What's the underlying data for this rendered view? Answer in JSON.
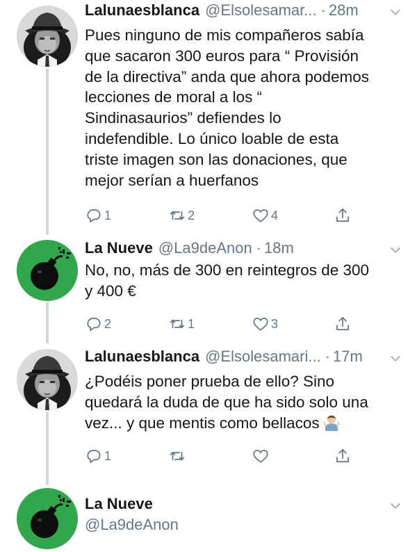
{
  "tweets": [
    {
      "display_name": "Lalunaesblanca",
      "handle": "@Elsolesamar...",
      "time": "28m",
      "text": "Pues ninguno de mis compañeros sabía\nque sacaron 300 euros para “ Provisión\nde la directiva” anda que ahora podemos\nlecciones de moral a los “\nSindinasaurios” defiendes lo\nindefendible. Lo único loable de esta\ntriste imagen son las donaciones, que\nmejor serían a huerfanos",
      "replies": "1",
      "retweets": "2",
      "likes": "4",
      "avatar_icon": "gangster-avatar-icon"
    },
    {
      "display_name": "La Nueve",
      "handle": "@La9deAnon",
      "time": "18m",
      "text": "No, no, más de 300 en reintegros de 300\ny 400 €",
      "replies": "2",
      "retweets": "1",
      "likes": "3",
      "avatar_icon": "bomb-avatar-icon"
    },
    {
      "display_name": "Lalunaesblanca",
      "handle": "@Elsolesamari...",
      "time": "17m",
      "text": "¿Podéis poner prueba de ello? Sino\nquedará la duda de que ha sido solo una\nvez... y que mentis como bellacos",
      "emoji": "shrug-emoji",
      "replies": "1",
      "retweets": "",
      "likes": "",
      "avatar_icon": "gangster-avatar-icon"
    },
    {
      "display_name": "La Nueve",
      "handle": "@La9deAnon",
      "avatar_icon": "bomb-avatar-icon"
    }
  ],
  "colors": {
    "text": "#14171a",
    "secondary": "#657786",
    "thread_line": "#cdd6dd",
    "bomb_bg": "#2ea84a"
  }
}
